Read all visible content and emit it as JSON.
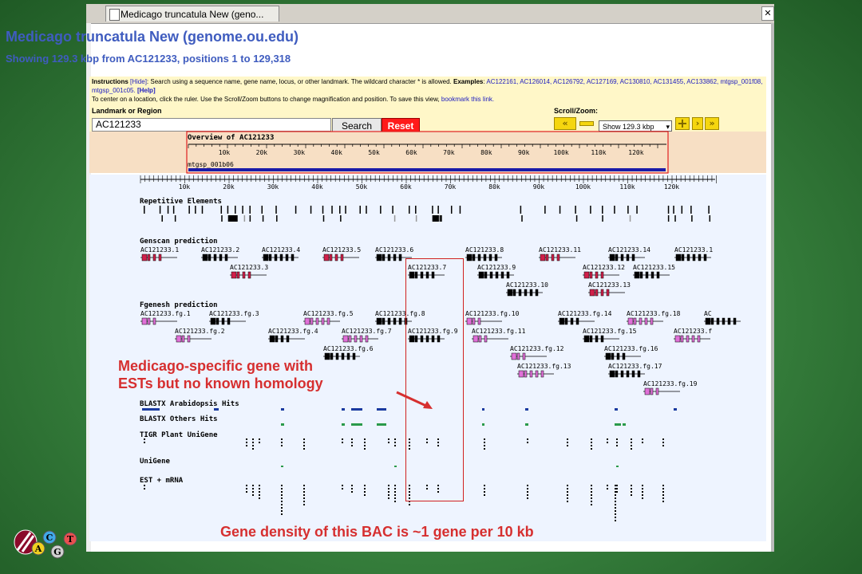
{
  "tab": {
    "title": "Medicago truncatula New (geno...",
    "close": "✕"
  },
  "header": {
    "title": "Medicago truncatula New (genome.ou.edu)",
    "subtitle": "Showing 129.3 kbp from AC121233, positions 1 to 129,318"
  },
  "instructions": {
    "label": "Instructions",
    "hide": "[Hide]",
    "text": ": Search using a sequence name, gene name, locus, or other landmark. The wildcard character * is allowed.",
    "examples_label": "Examples",
    "examples": [
      "AC122161",
      "AC126014",
      "AC126792",
      "AC127169",
      "AC130810",
      "AC131455",
      "AC133862",
      "mtgsp_001f08",
      "mtgsp_001c05"
    ],
    "help": "[Help]",
    "line2": "To center on a location, click the ruler. Use the Scroll/Zoom buttons to change magnification and position. To save this view, ",
    "bookmark": "bookmark this link."
  },
  "search": {
    "label": "Landmark or Region",
    "value": "AC121233",
    "search_button": "Search",
    "reset_button": "Reset",
    "scroll_label": "Scroll/Zoom:",
    "zoom_value": "Show 129.3 kbp"
  },
  "overview": {
    "title": "Overview of AC121233",
    "ticks": [
      "10k",
      "20k",
      "30k",
      "40k",
      "50k",
      "60k",
      "70k",
      "80k",
      "90k",
      "100k",
      "110k",
      "120k"
    ],
    "clone": "mtgsp_001b06"
  },
  "ruler_ticks": [
    "10k",
    "20k",
    "30k",
    "40k",
    "50k",
    "60k",
    "70k",
    "80k",
    "90k",
    "100k",
    "110k",
    "120k"
  ],
  "tracks": {
    "repeats": "Repetitive Elements",
    "genscan": "Genscan prediction",
    "fgenesh": "Fgenesh prediction",
    "blastx_arab": "BLASTX Arabidopsis Hits",
    "blastx_other": "BLASTX Others Hits",
    "tigr": "TIGR Plant UniGene",
    "unigene": "UniGene",
    "est": "EST + mRNA"
  },
  "genscan_genes": [
    "AC121233.1",
    "AC121233.2",
    "AC121233.4",
    "AC121233.5",
    "AC121233.6",
    "AC121233.8",
    "AC121233.11",
    "AC121233.14",
    "AC121233.1",
    "AC121233.3",
    "AC121233.7",
    "AC121233.9",
    "AC121233.12",
    "AC121233.15",
    "AC121233.10",
    "AC121233.13"
  ],
  "fgenesh_genes": [
    "AC121233.fg.1",
    "AC121233.fg.3",
    "AC121233.fg.5",
    "AC121233.fg.8",
    "AC121233.fg.10",
    "AC121233.fg.14",
    "AC121233.fg.18",
    "AC",
    "AC121233.fg.2",
    "AC121233.fg.4",
    "AC121233.fg.7",
    "AC121233.fg.9",
    "AC121233.fg.11",
    "AC121233.fg.15",
    "AC121233.f",
    "AC121233.fg.6",
    "AC121233.fg.12",
    "AC121233.fg.16",
    "AC121233.fg.13",
    "AC121233.fg.17",
    "AC121233.fg.19"
  ],
  "annotations": {
    "medicago_line1": "Medicago-specific gene with",
    "medicago_line2": "ESTs but no known homology",
    "density": "Gene density of this BAC is ~1 gene per 10 kb"
  },
  "logo_letters": [
    "A",
    "C",
    "G",
    "T"
  ],
  "colors": {
    "title_blue": "#3f5cbf",
    "annotation_red": "#d62f2f",
    "reset_red": "#ff1a1a",
    "gene_red": "#d0204a",
    "gene_pink": "#e070d8",
    "blast_blue": "#1a3aa0",
    "blast_green": "#2a9a4a"
  }
}
